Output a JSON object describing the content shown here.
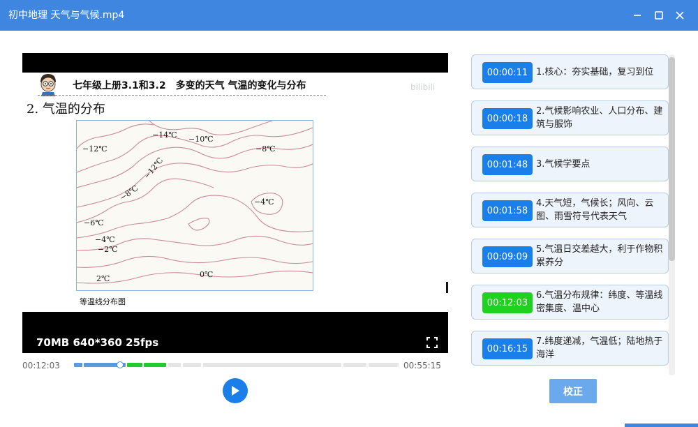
{
  "window": {
    "title": "初中地理 天气与气候.mp4"
  },
  "video": {
    "slide_header": "七年级上册3.1和3.2　多变的天气  气温的变化与分布",
    "watermark": "bilibili",
    "slide_subtitle": "2. 气温的分布",
    "map_caption": "等温线分布图",
    "map_labels": [
      "−12℃",
      "−14℃",
      "−10℃",
      "−8℃",
      "−12℃",
      "−8℃",
      "−4℃",
      "−6℃",
      "−4℃",
      "−2℃",
      "2℃",
      "0℃"
    ],
    "info": "70MB 640*360 25fps"
  },
  "playback": {
    "current_time": "00:12:03",
    "total_time": "00:55:15",
    "progress": 0.218
  },
  "chapters": [
    {
      "time": "00:00:11",
      "text": "1.核心：夯实基础，复习到位",
      "current": false
    },
    {
      "time": "00:00:18",
      "text": "2.气候影响农业、人口分布、建筑与服饰",
      "current": false
    },
    {
      "time": "00:01:48",
      "text": "3.气候学要点",
      "current": false
    },
    {
      "time": "00:01:58",
      "text": "4.天气短，气候长；风向、云图、雨雪符号代表天气",
      "current": false
    },
    {
      "time": "00:09:09",
      "text": "5.气温日交差越大，利于作物积累养分",
      "current": false
    },
    {
      "time": "00:12:03",
      "text": "6.气温分布规律：纬度、等温线密集度、温中心",
      "current": true
    },
    {
      "time": "00:16:15",
      "text": "7.纬度递减，气温低；陆地热于海洋",
      "current": false
    }
  ],
  "confirm_label": "校正",
  "colors": {
    "titlebar": "#3f86e0",
    "timestamp": "#1a7fe8",
    "current_timestamp": "#1fd21f",
    "isotherm": "#c98a94"
  }
}
